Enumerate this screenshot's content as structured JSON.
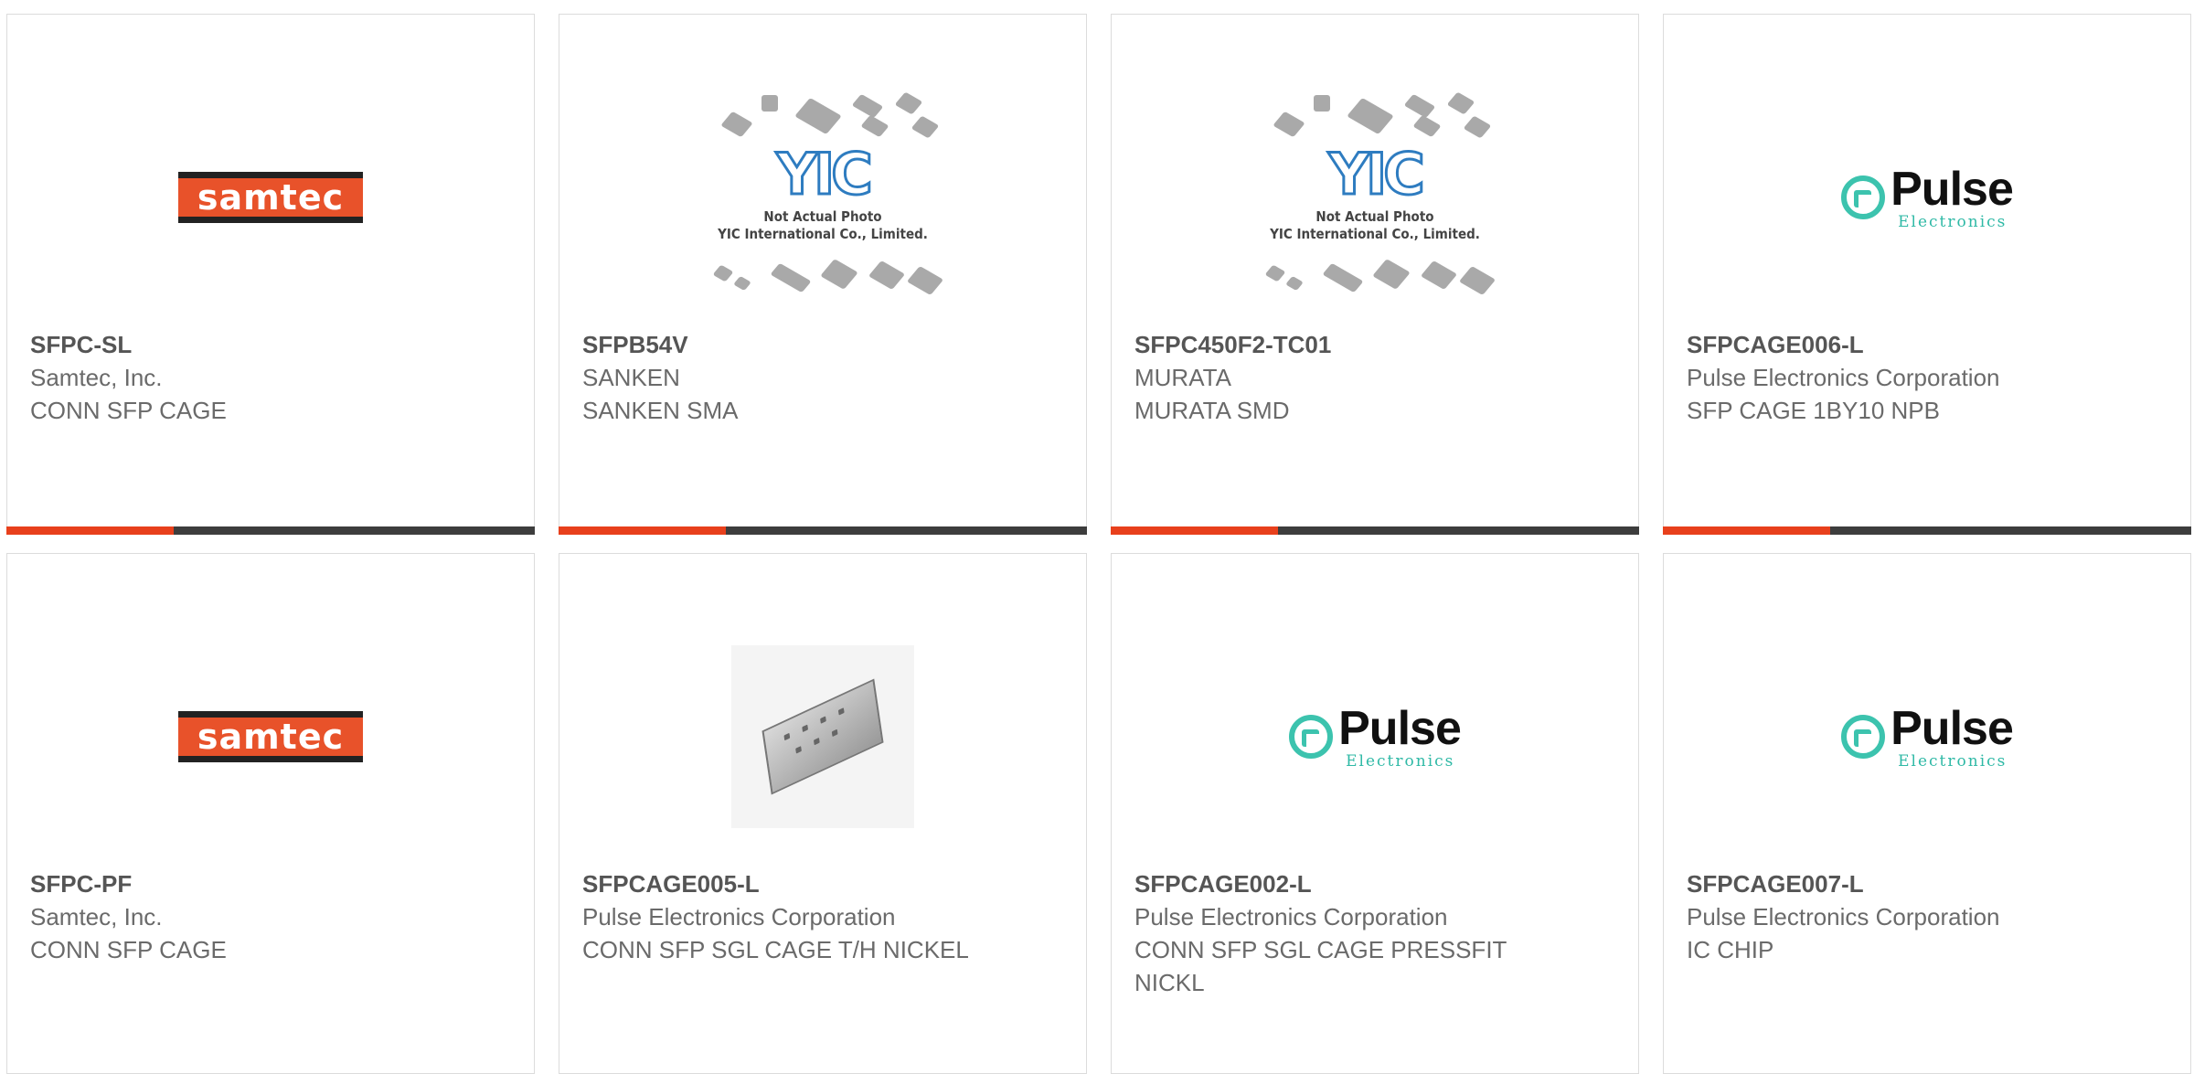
{
  "colors": {
    "accent": "#e8401c",
    "bar": "#3d3d3d",
    "samtec": "#e8522a",
    "pulse": "#3cc3ae",
    "yic": "#2e7cc0"
  },
  "cards": [
    {
      "part": "SFPC-SL",
      "manufacturer": "Samtec, Inc.",
      "description": "CONN SFP CAGE",
      "logo": "samtec"
    },
    {
      "part": "SFPB54V",
      "manufacturer": "SANKEN",
      "description": "SANKEN SMA",
      "logo": "yic-placeholder"
    },
    {
      "part": "SFPC450F2-TC01",
      "manufacturer": "MURATA",
      "description": "MURATA SMD",
      "logo": "yic-placeholder"
    },
    {
      "part": "SFPCAGE006-L",
      "manufacturer": "Pulse Electronics Corporation",
      "description": "SFP CAGE 1BY10 NPB",
      "logo": "pulse"
    },
    {
      "part": "SFPC-PF",
      "manufacturer": "Samtec, Inc.",
      "description": "CONN SFP CAGE",
      "logo": "samtec"
    },
    {
      "part": "SFPCAGE005-L",
      "manufacturer": "Pulse Electronics Corporation",
      "description": "CONN SFP SGL CAGE T/H NICKEL",
      "logo": "product-photo"
    },
    {
      "part": "SFPCAGE002-L",
      "manufacturer": "Pulse Electronics Corporation",
      "description": "CONN SFP SGL CAGE PRESSFIT NICKL",
      "logo": "pulse"
    },
    {
      "part": "SFPCAGE007-L",
      "manufacturer": "Pulse Electronics Corporation",
      "description": "IC CHIP",
      "logo": "pulse"
    }
  ],
  "logos": {
    "samtec": {
      "word": "samtec"
    },
    "pulse": {
      "word": "Pulse",
      "sub": "Electronics"
    },
    "yic": {
      "word": "YIC",
      "line1": "Not Actual Photo",
      "line2": "YIC International Co., Limited."
    }
  }
}
